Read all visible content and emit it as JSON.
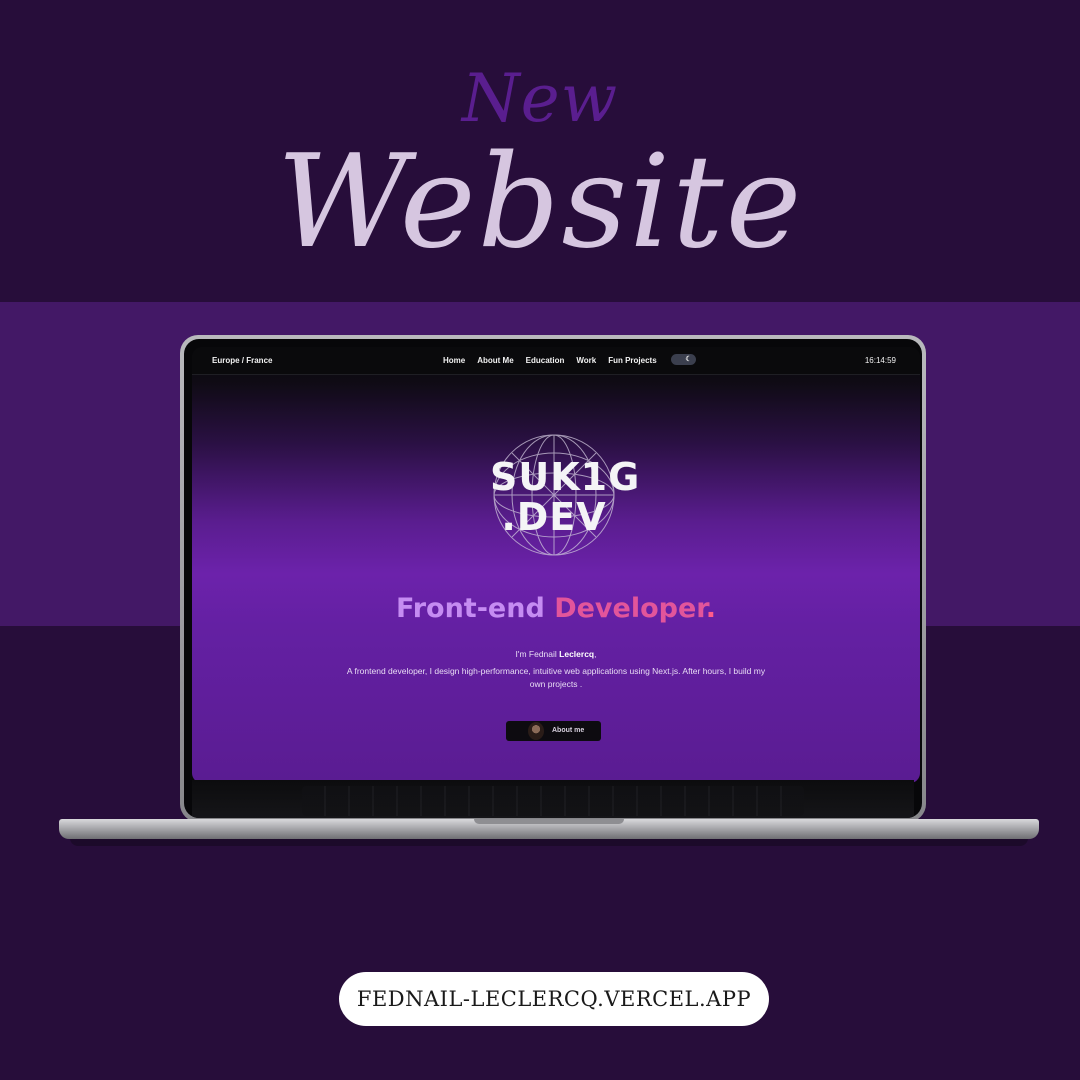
{
  "heading": {
    "line1": "New",
    "line2": "Website"
  },
  "site": {
    "nav": {
      "location": "Europe / France",
      "links": [
        "Home",
        "About Me",
        "Education",
        "Work",
        "Fun Projects"
      ],
      "theme_toggle_icon": "moon-icon",
      "time": "16:14:59"
    },
    "logo": {
      "line1": "SUK1G",
      "line2": ".DEV"
    },
    "headline": {
      "part1": "Front-end",
      "part2": "Developer",
      "dot": "."
    },
    "intro": {
      "prefix": "I'm Fednail ",
      "name": "Leclercq",
      "suffix": ","
    },
    "description": "A frontend developer, I design high-performance, intuitive web applications using Next.js. After hours, I build my own projects .",
    "about_button": "About me"
  },
  "url": "FEDNAIL-LECLERCQ.VERCEL.APP",
  "colors": {
    "background": "#270d3a",
    "band": "#431866",
    "accent_purple": "#c58cf2",
    "accent_pink": "#e2559b"
  }
}
